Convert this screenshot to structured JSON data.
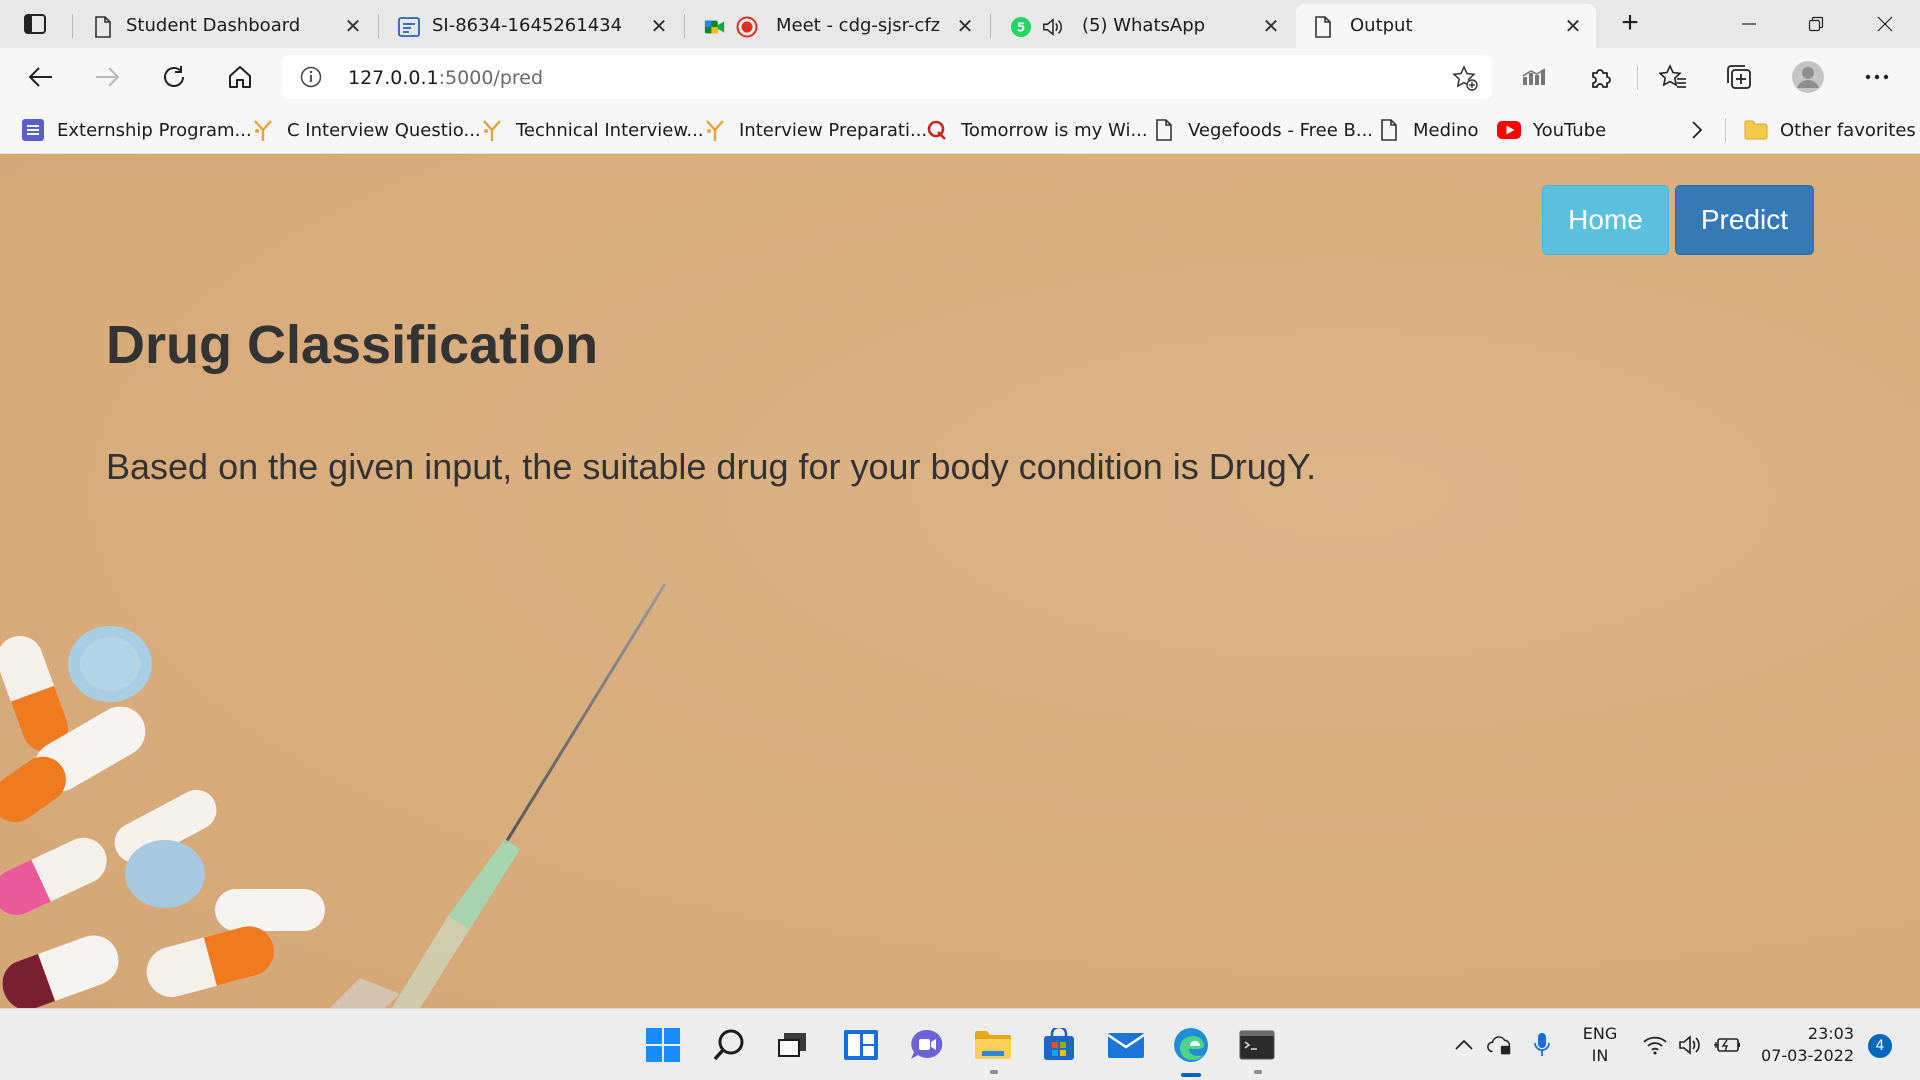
{
  "browser": {
    "tabs": [
      {
        "title": "Student Dashboard",
        "icon": "page-icon"
      },
      {
        "title": "SI-8634-1645261434",
        "icon": "form-icon"
      },
      {
        "title": "Meet - cdg-sjsr-cfz",
        "icon": "meet-icon",
        "recording": true
      },
      {
        "title": "(5) WhatsApp",
        "icon": "whatsapp-icon",
        "badge": "5",
        "audio": true
      },
      {
        "title": "Output",
        "icon": "page-icon",
        "active": true
      }
    ],
    "address": {
      "host": "127.0.0.1",
      "path": ":5000/pred"
    },
    "favorites": [
      {
        "label": "Externship Program...",
        "icon": "list-icon"
      },
      {
        "label": "C Interview Questio...",
        "icon": "interviewbit-icon"
      },
      {
        "label": "Technical Interview...",
        "icon": "interviewbit-icon"
      },
      {
        "label": "Interview Preparati...",
        "icon": "interviewbit-icon"
      },
      {
        "label": "Tomorrow is my Wi...",
        "icon": "quora-icon"
      },
      {
        "label": "Vegefoods - Free B...",
        "icon": "page-icon"
      },
      {
        "label": "Medino",
        "icon": "page-icon"
      },
      {
        "label": "YouTube",
        "icon": "youtube-icon"
      }
    ],
    "other_favorites": "Other favorites"
  },
  "page": {
    "nav": {
      "home": "Home",
      "predict": "Predict"
    },
    "title": "Drug Classification",
    "result": "Based on the given input, the suitable drug for your body condition is DrugY."
  },
  "taskbar": {
    "lang_line1": "ENG",
    "lang_line2": "IN",
    "time": "23:03",
    "date": "07-03-2022",
    "notifications": "4"
  },
  "colors": {
    "page_background": "#d9ad7e",
    "home_button": "#5bc0de",
    "predict_button": "#337ab7",
    "text": "#333333"
  }
}
